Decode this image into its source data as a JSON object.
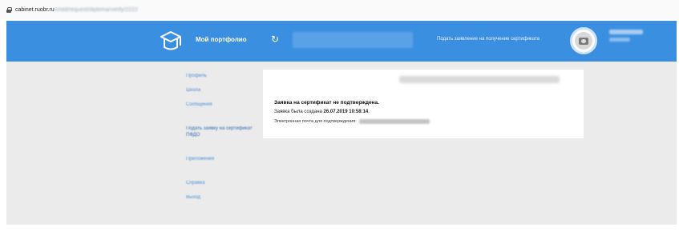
{
  "browser": {
    "url_domain": "cabinet.ruobr.ru",
    "url_path": "/child/request/diploma/verify/2222"
  },
  "header": {
    "logo_text": "Мой портфолио",
    "refresh_icon": "↻",
    "right_link": "Подать заявление на получение сертификата",
    "accent_color": "#3b8fe0"
  },
  "sidebar": {
    "items": [
      {
        "label": "Профиль"
      },
      {
        "label": "Школа"
      },
      {
        "label": "Сообщения"
      },
      {
        "label": "Подать заявку на сертификат ПФДО"
      },
      {
        "label": "Приложения"
      },
      {
        "label": "Справка"
      },
      {
        "label": "Выход"
      }
    ]
  },
  "card": {
    "title": "Заявка на сертификат не подтверждена.",
    "created_prefix": "Заявка была создана ",
    "created_date": "26.07.2019 10:58:14",
    "created_suffix": ".",
    "email_label": "Электронная почта для подтверждения:"
  }
}
